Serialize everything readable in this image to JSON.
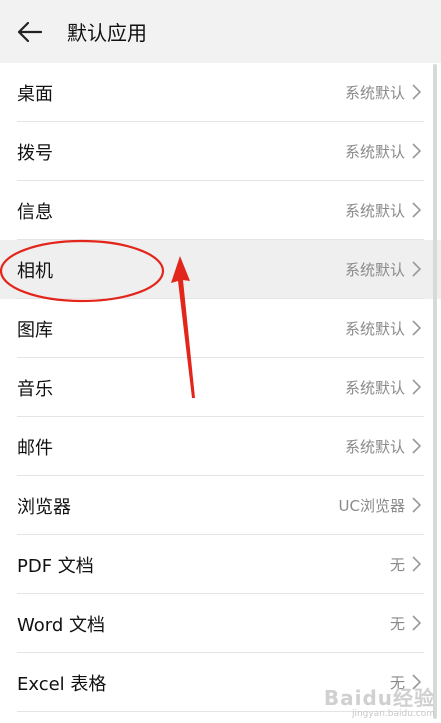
{
  "header": {
    "title": "默认应用"
  },
  "rows": [
    {
      "label": "桌面",
      "value": "系统默认"
    },
    {
      "label": "拨号",
      "value": "系统默认"
    },
    {
      "label": "信息",
      "value": "系统默认"
    },
    {
      "label": "相机",
      "value": "系统默认"
    },
    {
      "label": "图库",
      "value": "系统默认"
    },
    {
      "label": "音乐",
      "value": "系统默认"
    },
    {
      "label": "邮件",
      "value": "系统默认"
    },
    {
      "label": "浏览器",
      "value": "UC浏览器"
    },
    {
      "label": "PDF 文档",
      "value": "无"
    },
    {
      "label": "Word 文档",
      "value": "无"
    },
    {
      "label": "Excel 表格",
      "value": "无"
    }
  ],
  "annotation": {
    "color": "#e3261b"
  },
  "watermark": {
    "main": "Baidu经验",
    "sub": "jingyan.baidu.com"
  }
}
